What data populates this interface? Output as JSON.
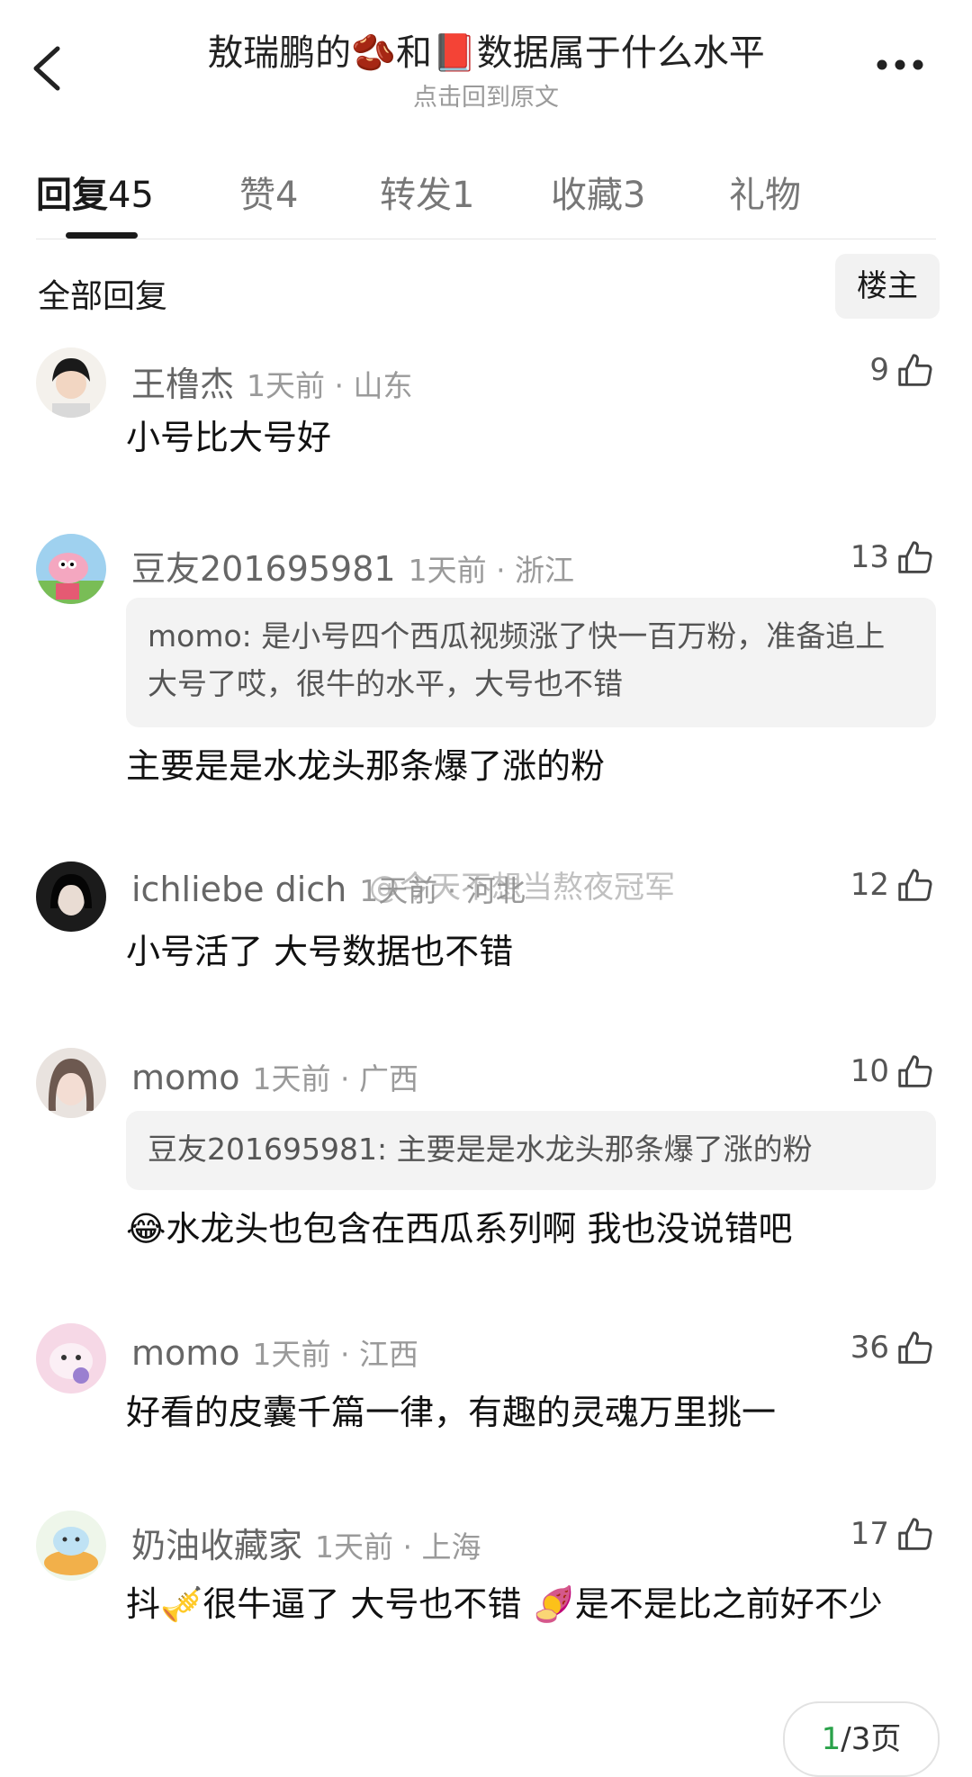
{
  "header": {
    "title": "敖瑞鹏的🫘和📕数据属于什么水平",
    "subtitle": "点击回到原文"
  },
  "tabs": [
    {
      "label": "回复",
      "count": "45"
    },
    {
      "label": "赞",
      "count": "4"
    },
    {
      "label": "转发",
      "count": "1"
    },
    {
      "label": "收藏",
      "count": "3"
    },
    {
      "label": "礼物",
      "count": ""
    }
  ],
  "section_label": "全部回复",
  "op_filter": "楼主",
  "watermark": "@今天不想当熬夜冠军",
  "comments": [
    {
      "user": "王橹杰",
      "time": "1天前 · 山东",
      "likes": "9",
      "quote": "",
      "text": "小号比大号好"
    },
    {
      "user": "豆友201695981",
      "time": "1天前 · 浙江",
      "likes": "13",
      "quote": "momo: 是小号四个西瓜视频涨了快一百万粉，准备追上大号了哎，很牛的水平，大号也不错",
      "text": "主要是是水龙头那条爆了涨的粉"
    },
    {
      "user": "ichliebe dich",
      "time": "1天前 · 河北",
      "likes": "12",
      "quote": "",
      "text": "小号活了 大号数据也不错"
    },
    {
      "user": "momo",
      "time": "1天前 · 广西",
      "likes": "10",
      "quote": "豆友201695981: 主要是是水龙头那条爆了涨的粉",
      "text": "😂水龙头也包含在西瓜系列啊 我也没说错吧"
    },
    {
      "user": "momo",
      "time": "1天前 · 江西",
      "likes": "36",
      "quote": "",
      "text": "好看的皮囊千篇一律，有趣的灵魂万里挑一"
    },
    {
      "user": "奶油收藏家",
      "time": "1天前 · 上海",
      "likes": "17",
      "quote": "",
      "text": "抖🎺很牛逼了 大号也不错 🍠是不是比之前好不少"
    }
  ],
  "pagination": {
    "current": "1",
    "total": "/3页"
  }
}
